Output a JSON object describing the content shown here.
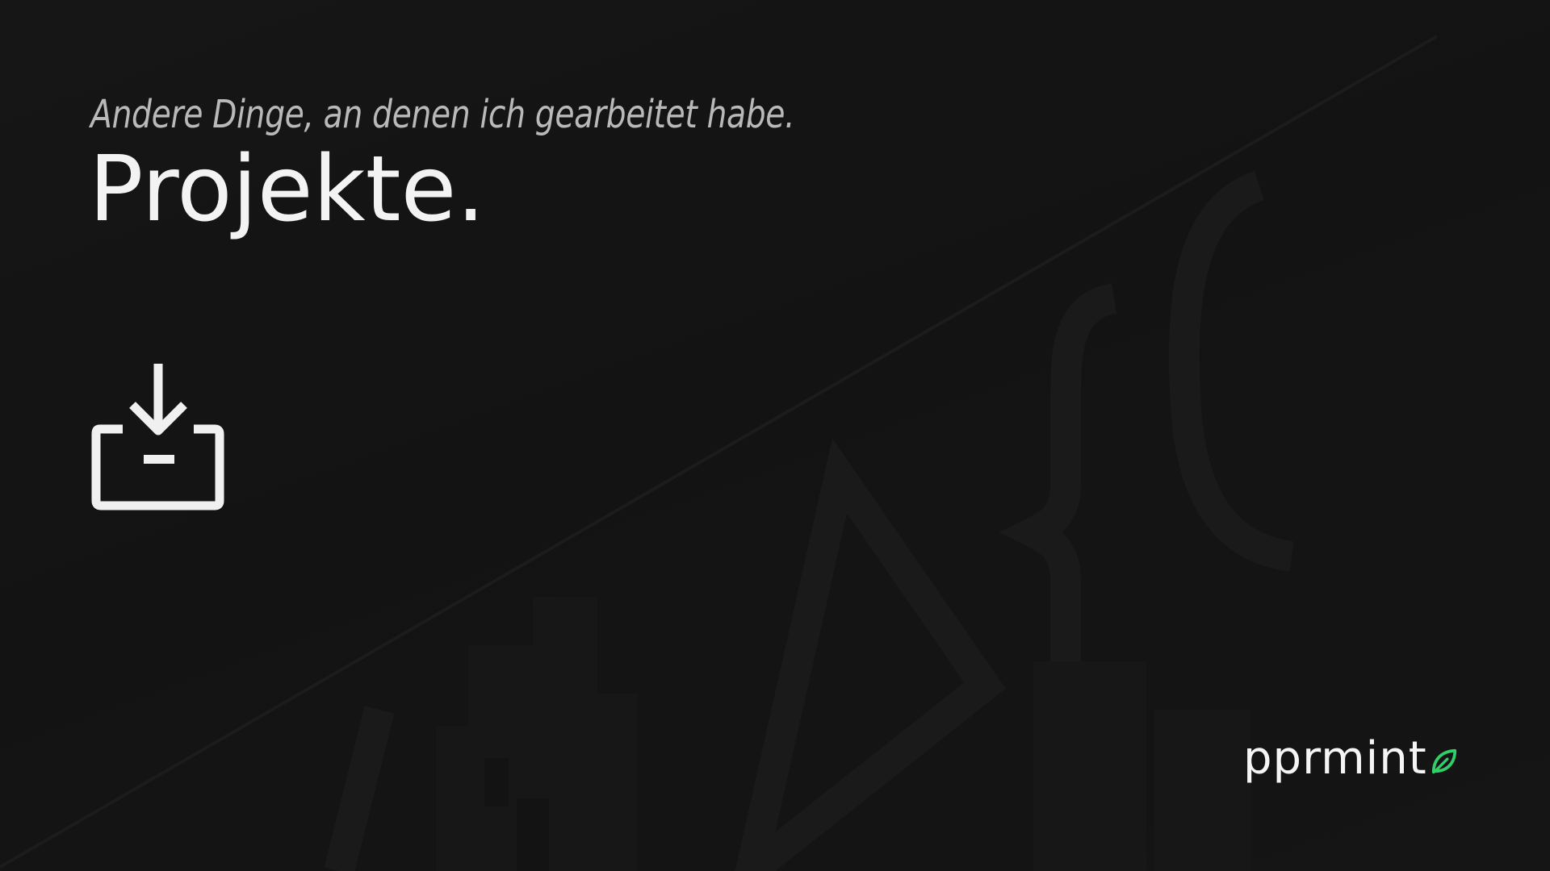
{
  "header": {
    "subtitle": "Andere Dinge, an denen ich gearbeitet habe.",
    "title": "Projekte."
  },
  "actions": {
    "install_icon": "download-tray-icon"
  },
  "brand": {
    "name": "pprmint",
    "leaf_icon": "leaf-icon",
    "accent_color": "#2fd06a"
  },
  "colors": {
    "background": "#131313",
    "foreground": "#f3f3f3",
    "muted": "#b9b9b9"
  }
}
